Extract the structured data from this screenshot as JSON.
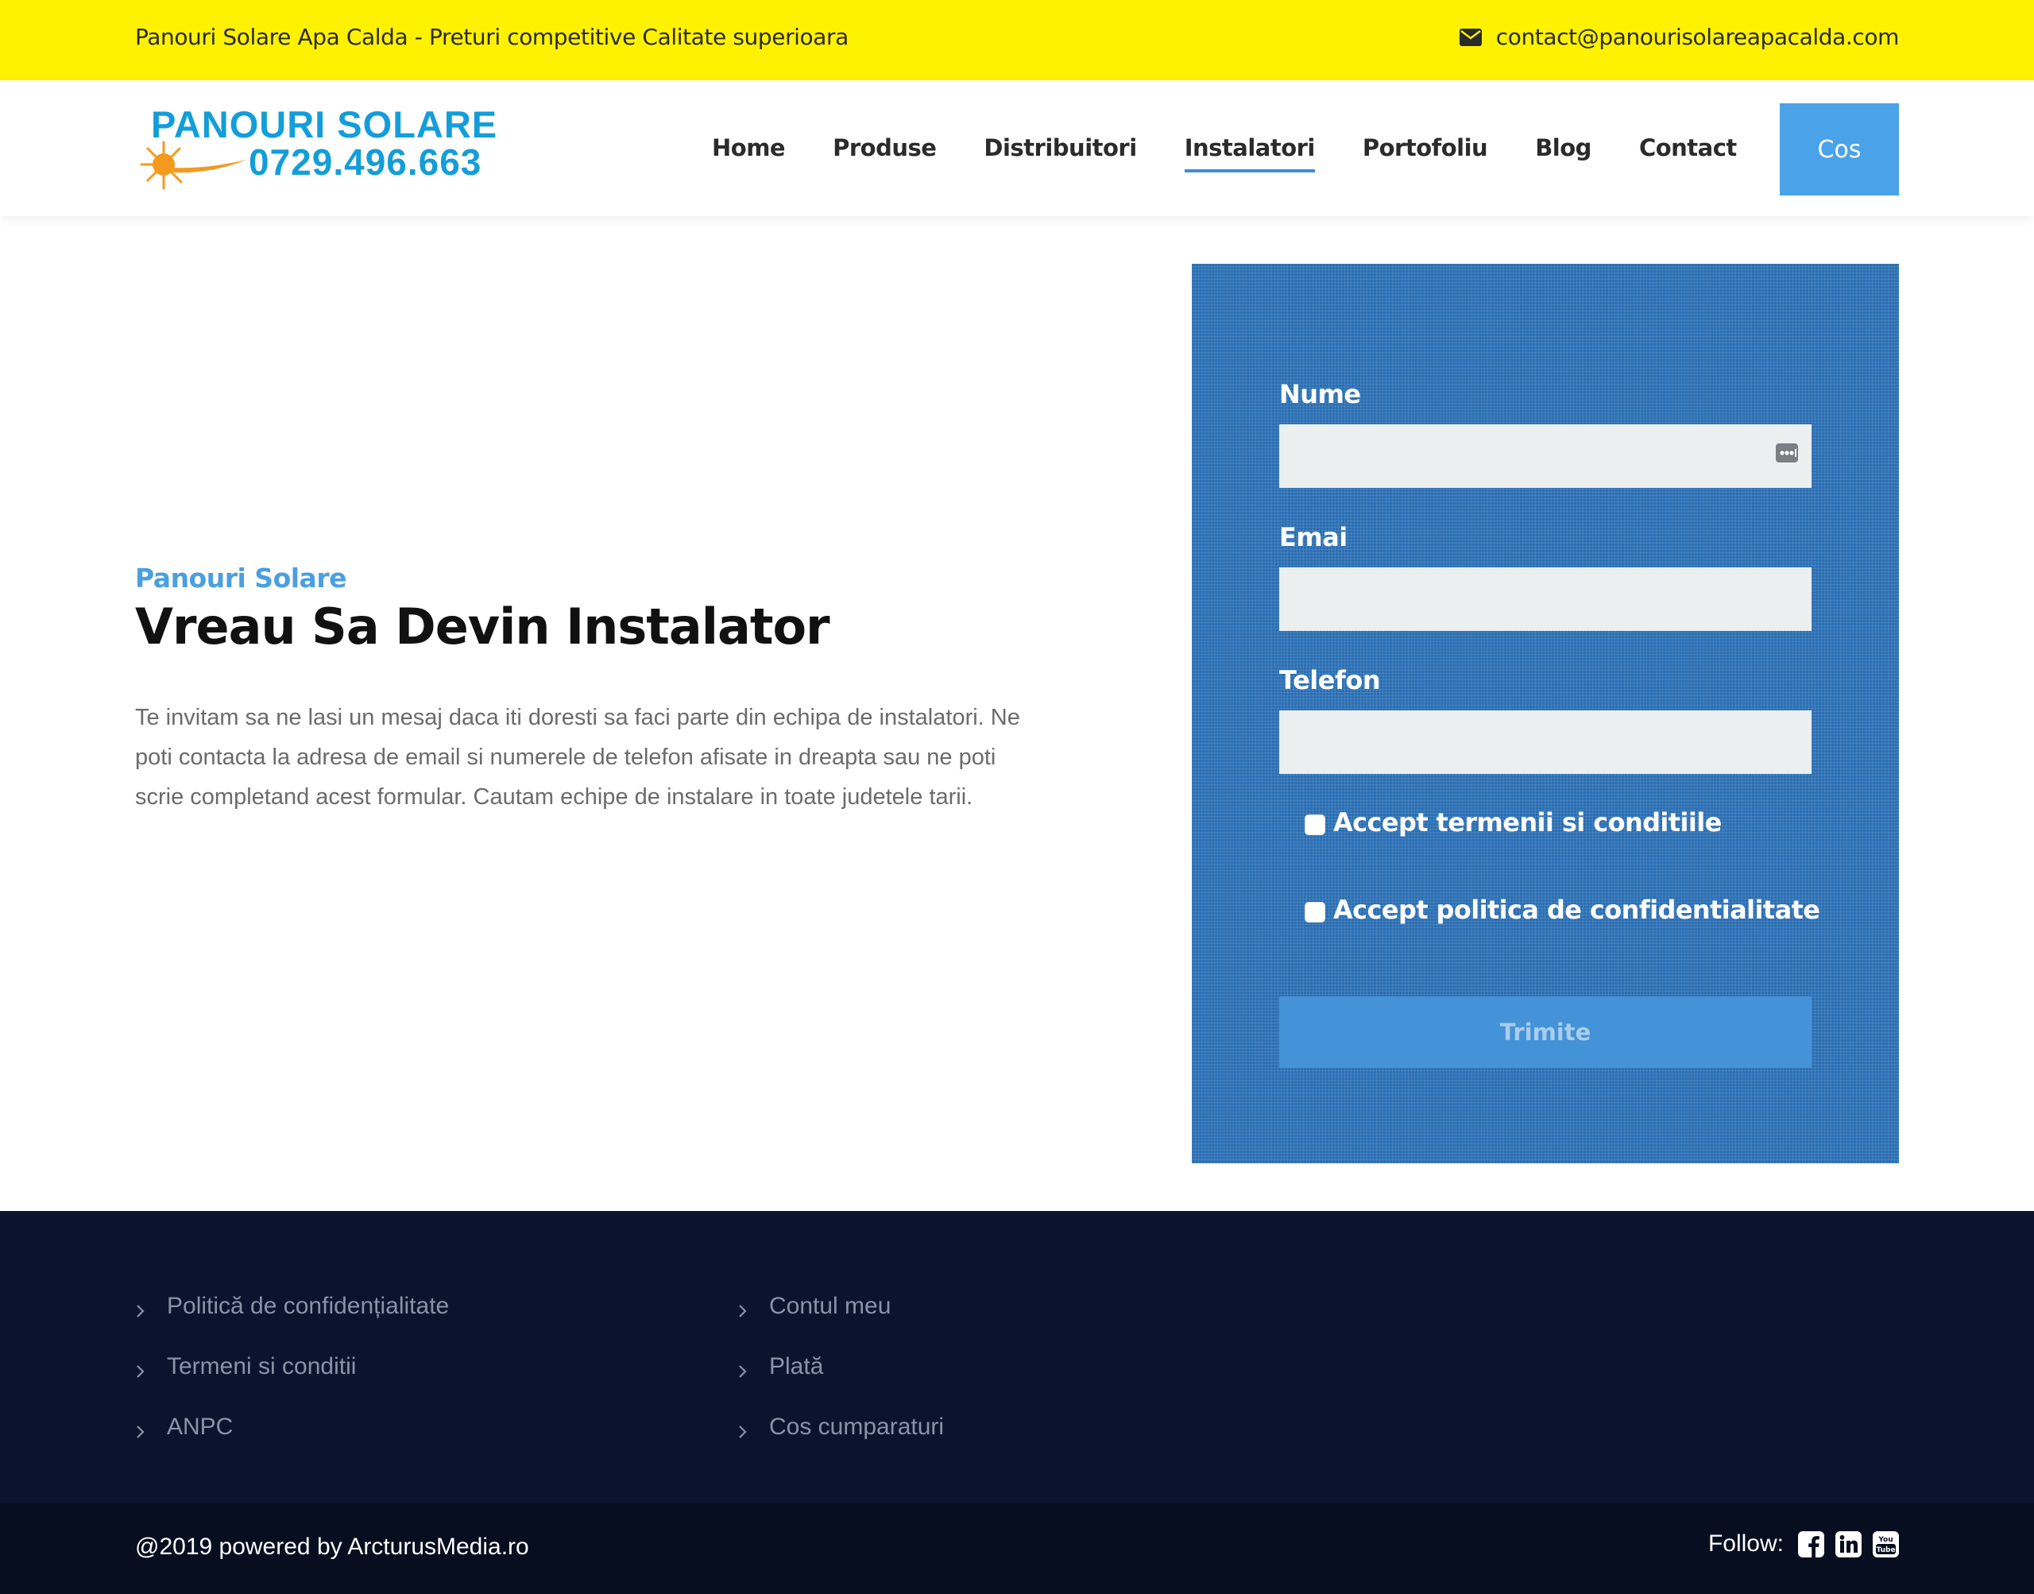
{
  "topbar": {
    "tagline": "Panouri Solare Apa Calda - Preturi competitive Calitate superioara",
    "email": "contact@panourisolareapacalda.com"
  },
  "header": {
    "logo": {
      "line1": "PANOURI SOLARE",
      "line2": "0729.496.663"
    },
    "nav": [
      {
        "label": "Home"
      },
      {
        "label": "Produse"
      },
      {
        "label": "Distribuitori"
      },
      {
        "label": "Instalatori"
      },
      {
        "label": "Portofoliu"
      },
      {
        "label": "Blog"
      },
      {
        "label": "Contact"
      }
    ],
    "active_nav": "Instalatori",
    "cart_label": "Cos"
  },
  "intro": {
    "kicker": "Panouri Solare",
    "title": "Vreau Sa Devin Instalator",
    "text": "Te invitam sa ne lasi un mesaj daca iti doresti sa faci parte din echipa de instalatori. Ne poti contacta la adresa de email si numerele de telefon afisate in dreapta sau ne poti scrie completand acest formular. Cautam echipe de instalare in toate judetele tarii."
  },
  "form": {
    "name_label": "Nume",
    "name_value": "",
    "email_label": "Emai",
    "email_value": "",
    "phone_label": "Telefon",
    "phone_value": "",
    "terms_label": "Accept termenii si conditiile",
    "terms_checked": false,
    "privacy_label": "Accept politica de confidentialitate",
    "privacy_checked": false,
    "submit_label": "Trimite"
  },
  "footer": {
    "col1": [
      {
        "label": "Politică de confidențialitate"
      },
      {
        "label": "Termeni si conditii"
      },
      {
        "label": "ANPC"
      }
    ],
    "col2": [
      {
        "label": "Contul meu"
      },
      {
        "label": "Plată"
      },
      {
        "label": "Cos cumparaturi"
      }
    ],
    "copyright": "@2019 powered by ArcturusMedia.ro",
    "follow_label": "Follow:",
    "social": [
      "facebook-icon",
      "linkedin-icon",
      "youtube-icon"
    ]
  },
  "colors": {
    "topbar_bg": "#fff200",
    "accent_blue": "#4aa3e8",
    "form_panel_bg": "#2b6fb3",
    "footer_bg": "#0a152d",
    "bottombar_bg": "#070e1f",
    "logo_blue": "#139ed9",
    "logo_orange": "#f39a1f"
  }
}
